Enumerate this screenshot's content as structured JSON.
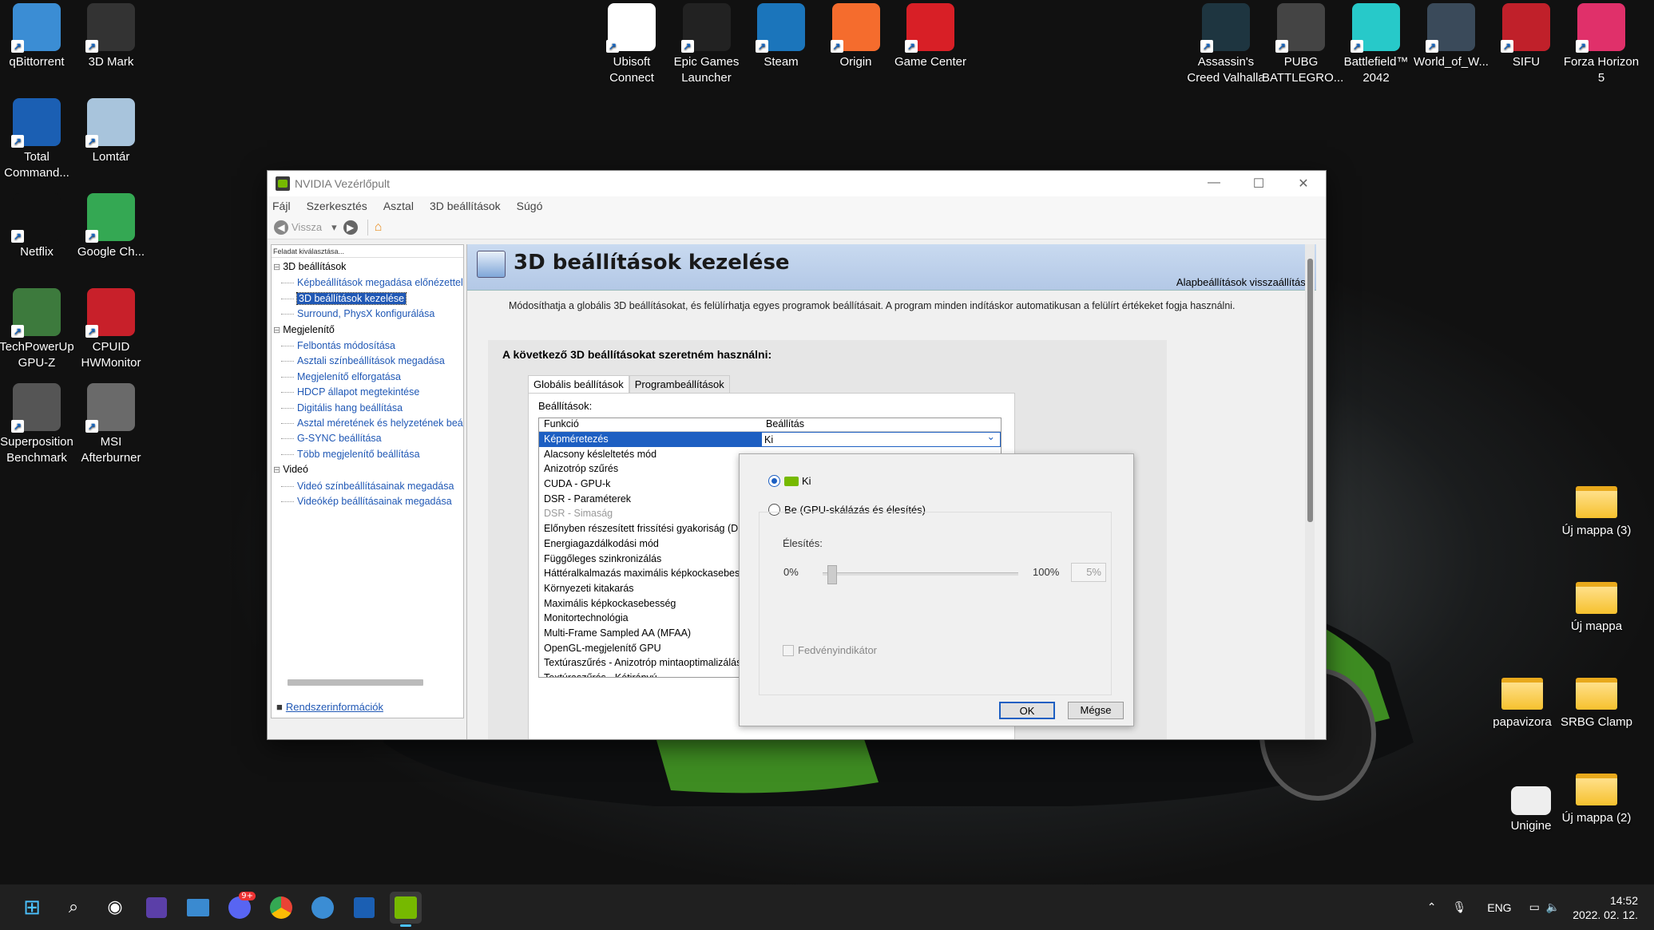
{
  "desktop": {
    "left_icons": [
      {
        "label": "qBittorrent",
        "icon": "qbittorrent-icon",
        "color": "#3b8dd4"
      },
      {
        "label": "3D Mark",
        "icon": "3dmark-icon",
        "color": "#333333"
      },
      {
        "label": "Total\nCommand...",
        "icon": "total-commander-icon",
        "color": "#1b5fb3"
      },
      {
        "label": "Lomtár",
        "icon": "recycle-bin-icon",
        "color": "#a8c4dc"
      },
      {
        "label": "Netflix",
        "icon": "netflix-icon",
        "color": "#111111"
      },
      {
        "label": "Google Ch...",
        "icon": "chrome-icon",
        "color": "#34a853"
      },
      {
        "label": "TechPowerUp\nGPU-Z",
        "icon": "gpuz-icon",
        "color": "#3d7a3d"
      },
      {
        "label": "CPUID\nHWMonitor",
        "icon": "hwmonitor-icon",
        "color": "#c8202a"
      },
      {
        "label": "Superposition\nBenchmark",
        "icon": "superposition-icon",
        "color": "#555555"
      },
      {
        "label": "MSI\nAfterburner",
        "icon": "afterburner-icon",
        "color": "#6a6a6a"
      }
    ],
    "top_icons": [
      {
        "label": "Ubisoft\nConnect",
        "icon": "ubisoft-icon",
        "color": "#ffffff"
      },
      {
        "label": "Epic Games\nLauncher",
        "icon": "epic-games-icon",
        "color": "#222222"
      },
      {
        "label": "Steam",
        "icon": "steam-icon",
        "color": "#1b75bb"
      },
      {
        "label": "Origin",
        "icon": "origin-icon",
        "color": "#f56c2d"
      },
      {
        "label": "Game Center",
        "icon": "game-center-icon",
        "color": "#d81f26"
      }
    ],
    "right_icons": [
      {
        "label": "Assassin's\nCreed Valhalla",
        "icon": "valhalla-icon",
        "color": "#1e3540"
      },
      {
        "label": "PUBG\nBATTLEGRO...",
        "icon": "pubg-icon",
        "color": "#444444"
      },
      {
        "label": "Battlefield™\n2042",
        "icon": "battlefield-icon",
        "color": "#27c9c9"
      },
      {
        "label": "World_of_W...",
        "icon": "wows-icon",
        "color": "#3a4a5a"
      },
      {
        "label": "SIFU",
        "icon": "sifu-icon",
        "color": "#c0202a"
      },
      {
        "label": "Forza Horizon\n5",
        "icon": "forza-icon",
        "color": "#e0306a"
      }
    ],
    "folders": [
      {
        "label": "Új mappa (3)"
      },
      {
        "label": "Új mappa"
      },
      {
        "label": "papavizora"
      },
      {
        "label": "SRBG Clamp"
      },
      {
        "label": "Új mappa (2)"
      }
    ],
    "unigine_label": "Unigine"
  },
  "window": {
    "title": "NVIDIA Vezérlőpult",
    "menu": [
      "Fájl",
      "Szerkesztés",
      "Asztal",
      "3D beállítások",
      "Súgó"
    ],
    "back_label": "Vissza",
    "task_header": "Feladat kiválasztása...",
    "tree": [
      {
        "cat": "3D beállítások",
        "items": [
          "Képbeállítások megadása előnézettel",
          "3D beállítások kezelése",
          "Surround, PhysX konfigurálása"
        ]
      },
      {
        "cat": "Megjelenítő",
        "items": [
          "Felbontás módosítása",
          "Asztali színbeállítások megadása",
          "Megjelenítő elforgatása",
          "HDCP állapot megtekintése",
          "Digitális hang beállítása",
          "Asztal méretének és helyzetének beállítása",
          "G-SYNC beállítása",
          "Több megjelenítő beállítása"
        ]
      },
      {
        "cat": "Videó",
        "items": [
          "Videó színbeállításainak megadása",
          "Videókép beállításainak megadása"
        ]
      }
    ],
    "selected_tree_item": "3D beállítások kezelése",
    "sysinfo_label": "Rendszerinformációk",
    "page_title": "3D beállítások kezelése",
    "restore_defaults": "Alapbeállítások visszaállítása",
    "description": "Módosíthatja a globális 3D beállításokat, és felülírhatja egyes programok beállításait. A program minden indításkor automatikusan a felülírt értékeket fogja használni.",
    "section_title": "A következő 3D beállításokat szeretném használni:",
    "tabs": [
      "Globális beállítások",
      "Programbeállítások"
    ],
    "settings_label": "Beállítások:",
    "col_function": "Funkció",
    "col_setting": "Beállítás",
    "selected_row": {
      "function": "Képméretezés",
      "setting": "Ki"
    },
    "rows": [
      "Alacsony késleltetés mód",
      "Anizotróp szűrés",
      "CUDA - GPU-k",
      "DSR - Paraméterek",
      "DSR - Simaság",
      "Előnyben részesített frissítési gyakoriság (D...",
      "Energiagazdálkodási mód",
      "Függőleges szinkronizálás",
      "Háttéralkalmazás maximális képkockasebes...",
      "Környezeti kitakarás",
      "Maximális képkockasebesség",
      "Monitortechnológia",
      "Multi-Frame Sampled AA (MFAA)",
      "OpenGL-megjelenítő GPU",
      "Textúraszűrés - Anizotróp mintaoptimalizálás",
      "Textúraszűrés - Kétirányú..."
    ],
    "disabled_row": "DSR - Simaság"
  },
  "popup": {
    "option_off": "Ki",
    "option_on": "Be (GPU-skálázás és élesítés)",
    "sharpen_label": "Élesítés:",
    "min_label": "0%",
    "max_label": "100%",
    "value": "5%",
    "sharpen_level": 0.05,
    "highlight_label": "Fedvényindikátor",
    "ok": "OK",
    "cancel": "Mégse"
  },
  "taskbar": {
    "apps": [
      "windows-start-icon",
      "search-icon",
      "obs-icon",
      "app-icon",
      "remote-desktop-icon",
      "discord-icon",
      "chrome-icon",
      "qbittorrent-icon",
      "total-commander-icon",
      "nvidia-icon"
    ],
    "discord_badge": "9+",
    "language": "ENG",
    "time": "14:52",
    "date": "2022. 02. 12."
  }
}
